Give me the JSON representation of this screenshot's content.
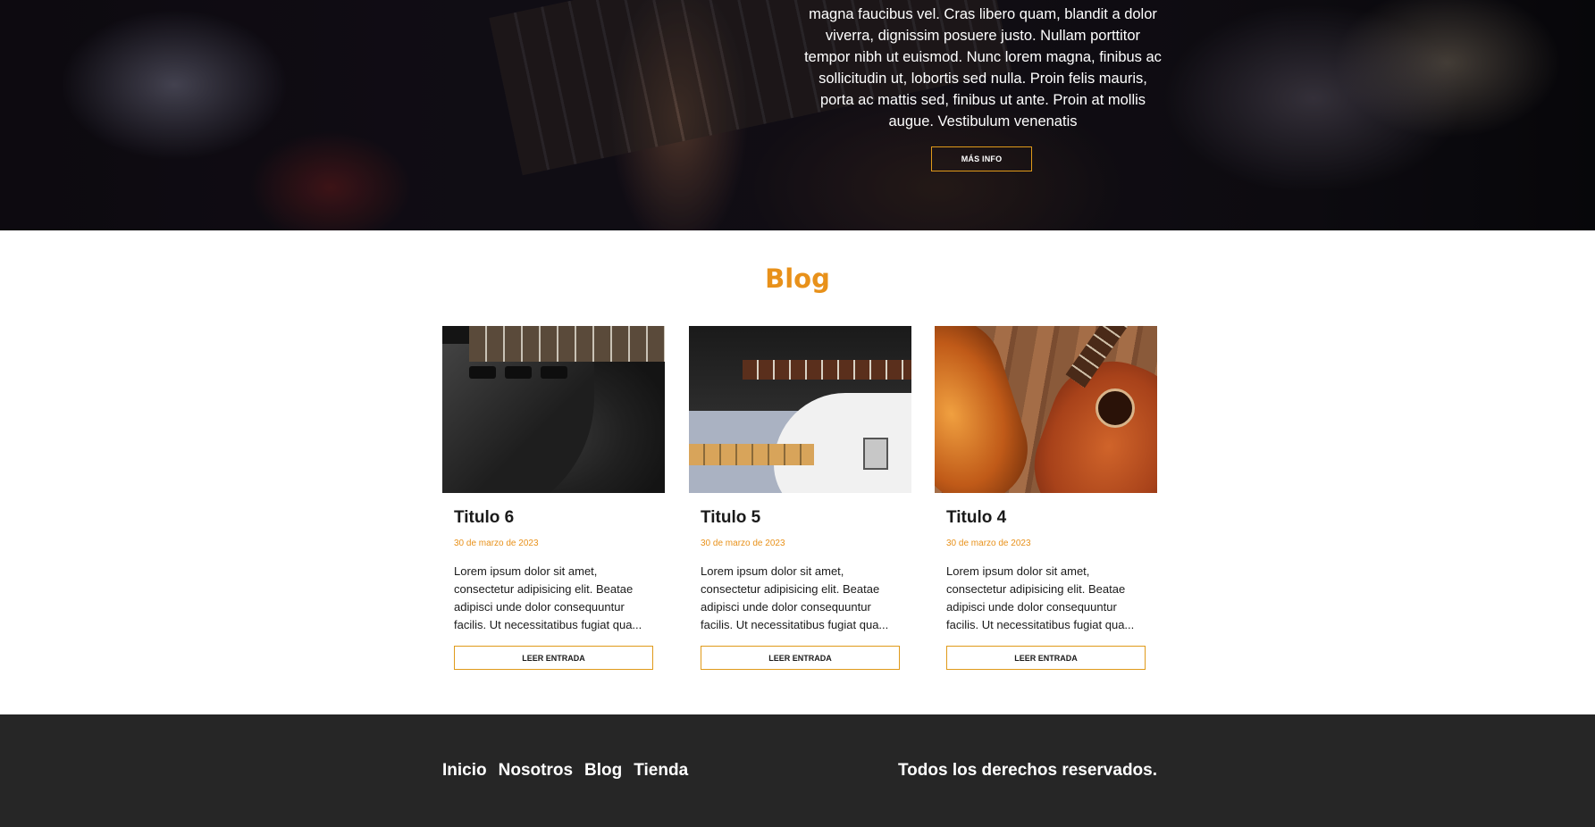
{
  "hero": {
    "text": "magna faucibus vel. Cras libero quam, blandit a dolor viverra, dignissim posuere justo. Nullam porttitor tempor nibh ut euismod. Nunc lorem magna, finibus ac sollicitudin ut, lobortis sed nulla. Proin felis mauris, porta ac mattis sed, finibus ut ante. Proin at mollis augue. Vestibulum venenatis",
    "button_label": "MÁS INFO"
  },
  "blog": {
    "title": "Blog",
    "posts": [
      {
        "title": "Titulo 6",
        "date": "30 de marzo de 2023",
        "excerpt": "Lorem ipsum dolor sit amet, consectetur adipisicing elit. Beatae adipisci unde dolor consequuntur facilis. Ut necessitatibus fugiat qua...",
        "button_label": "LEER ENTRADA"
      },
      {
        "title": "Titulo 5",
        "date": "30 de marzo de 2023",
        "excerpt": "Lorem ipsum dolor sit amet, consectetur adipisicing elit. Beatae adipisci unde dolor consequuntur facilis. Ut necessitatibus fugiat qua...",
        "button_label": "LEER ENTRADA"
      },
      {
        "title": "Titulo 4",
        "date": "30 de marzo de 2023",
        "excerpt": "Lorem ipsum dolor sit amet, consectetur adipisicing elit. Beatae adipisci unde dolor consequuntur facilis. Ut necessitatibus fugiat qua...",
        "button_label": "LEER ENTRADA"
      }
    ]
  },
  "footer": {
    "nav": [
      "Inicio",
      "Nosotros",
      "Blog",
      "Tienda"
    ],
    "copyright": "Todos los derechos reservados."
  },
  "colors": {
    "accent": "#e8911a",
    "footer_bg": "#262626",
    "text": "#1a1a1a"
  }
}
